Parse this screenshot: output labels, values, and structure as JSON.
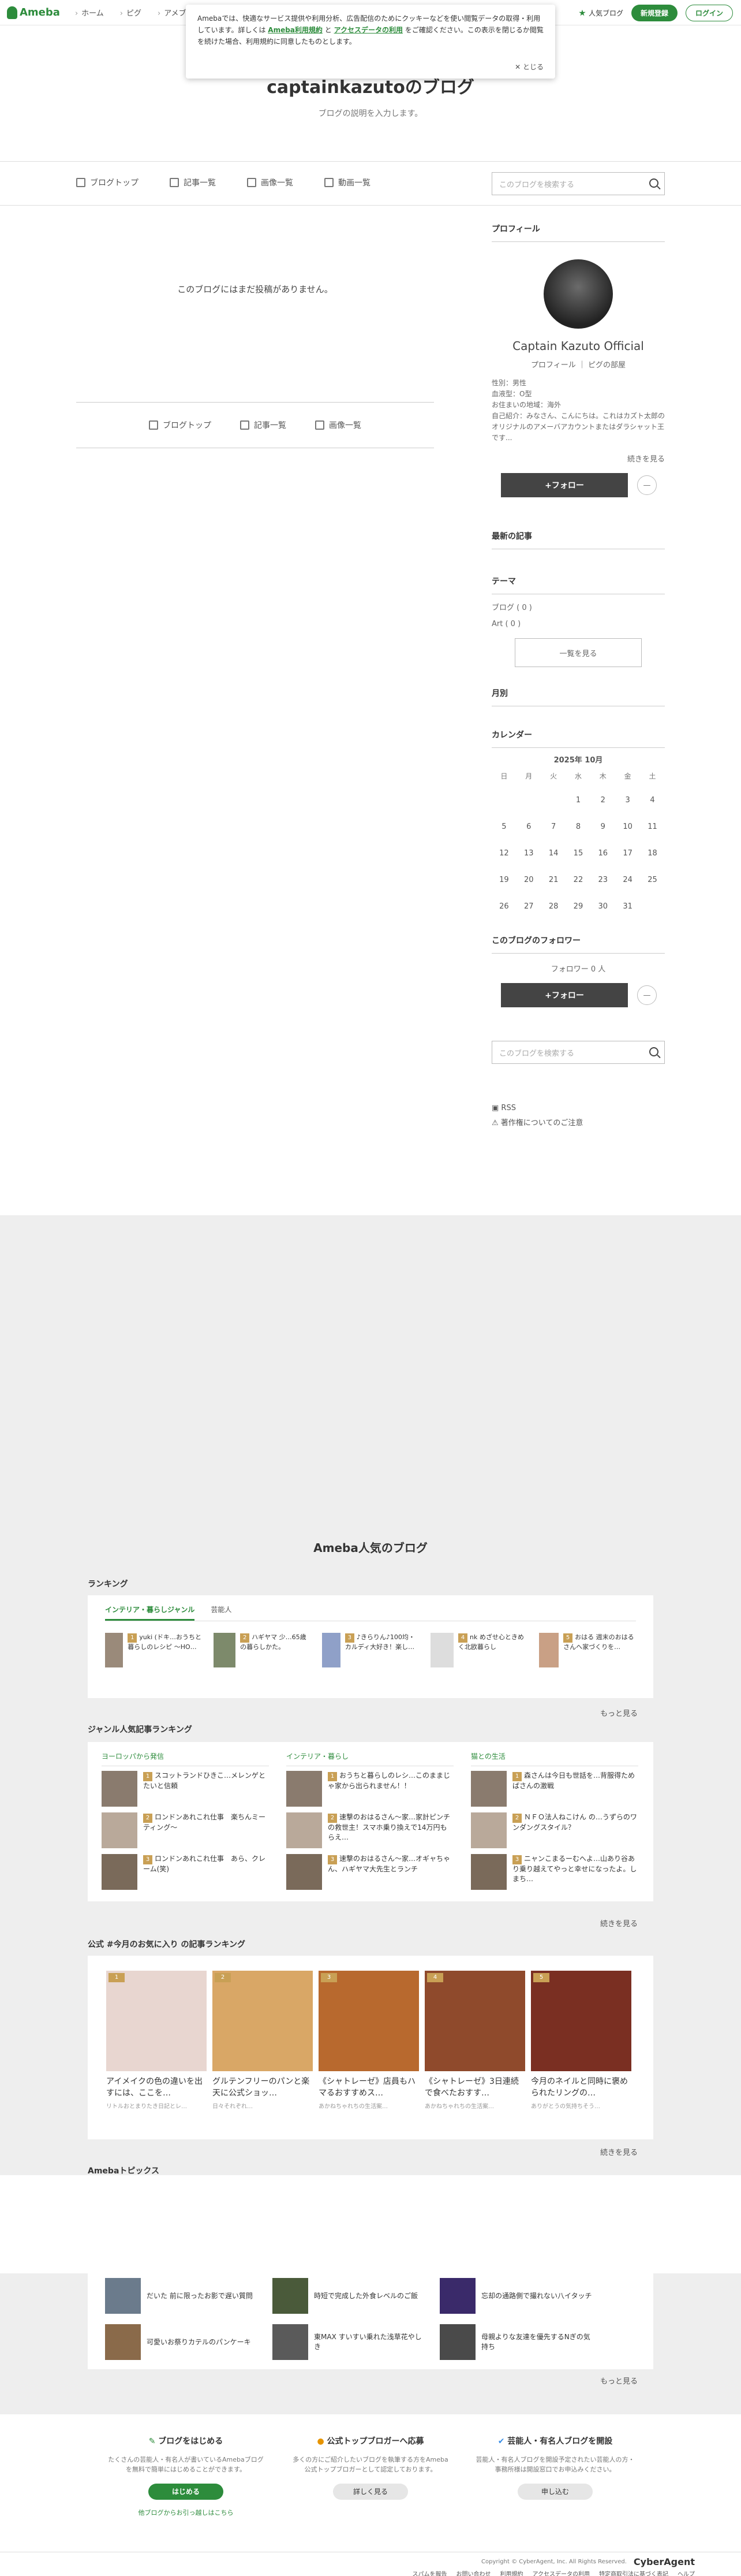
{
  "topbar": {
    "logo": "Ameba",
    "nav": [
      "ホーム",
      "ピグ",
      "アメブロ"
    ],
    "popular": "人気ブログ",
    "signup": "新規登録",
    "login": "ログイン"
  },
  "cookie": {
    "text1": "Amebaでは、快適なサービス提供や利用分析、広告配信のためにクッキーなどを使い閲覧データの取得・利用しています。詳しくは",
    "link1": "Ameba利用規約",
    "and": "と",
    "link2": "アクセスデータの利用",
    "text2": "をご確認ください。この表示を閉じるか閲覧を続けた場合、利用規約に同意したものとします。",
    "close": "とじる"
  },
  "header": {
    "title": "captainkazutoのブログ",
    "desc": "ブログの説明を入力します。"
  },
  "subnav": {
    "items": [
      "ブログトップ",
      "記事一覧",
      "画像一覧",
      "動画一覧"
    ],
    "search_placeholder": "このブログを検索する"
  },
  "main": {
    "empty": "このブログにはまだ投稿がありません。",
    "bottom_nav": [
      "ブログトップ",
      "記事一覧",
      "画像一覧"
    ]
  },
  "profile": {
    "heading": "プロフィール",
    "name": "Captain Kazuto Official",
    "links": "プロフィール ｜ ピグの部屋",
    "gender": "性別：男性",
    "blood": "血液型：O型",
    "area": "お住まいの地域：海外",
    "intro": "自己紹介：みなさん、こんにちは。これはカズト太郎のオリジナルのアメーバアカウントまたはダラシャット王です...",
    "more": "続きを見る",
    "follow": "+フォロー"
  },
  "recent": {
    "heading": "最新の記事"
  },
  "theme": {
    "heading": "テーマ",
    "items": [
      "ブログ ( 0 )",
      "Art ( 0 )"
    ],
    "button": "一覧を見る"
  },
  "month": {
    "heading": "月別"
  },
  "calendar": {
    "heading": "カレンダー",
    "title": "2025年 10月",
    "weekdays": [
      "日",
      "月",
      "火",
      "水",
      "木",
      "金",
      "土"
    ],
    "weeks": [
      [
        "",
        "",
        "",
        "1",
        "2",
        "3",
        "4"
      ],
      [
        "5",
        "6",
        "7",
        "8",
        "9",
        "10",
        "11"
      ],
      [
        "12",
        "13",
        "14",
        "15",
        "16",
        "17",
        "18"
      ],
      [
        "19",
        "20",
        "21",
        "22",
        "23",
        "24",
        "25"
      ],
      [
        "26",
        "27",
        "28",
        "29",
        "30",
        "31",
        ""
      ]
    ]
  },
  "followers": {
    "heading": "このブログのフォロワー",
    "count": "フォロワー 0 人",
    "follow": "+フォロー"
  },
  "side_search": {
    "placeholder": "このブログを検索する"
  },
  "side_links": {
    "rss": "RSS",
    "copyright": "著作権についてのご注意"
  },
  "popular": {
    "title": "Ameba人気のブログ",
    "ranking_heading": "ランキング",
    "tabs": [
      "インテリア・暮らしジャンル",
      "芸能人"
    ],
    "ranking": [
      {
        "rank": "1",
        "text": "yuki (ドキ…おうちと暮らしのレシピ ～HO…"
      },
      {
        "rank": "2",
        "text": "ハギヤマ 少…65歳の暮らしかた。"
      },
      {
        "rank": "3",
        "text": "♪きらりん♪100均・カルディ大好き！楽し…"
      },
      {
        "rank": "4",
        "text": "nk めざせ心ときめく北欧暮らし"
      },
      {
        "rank": "5",
        "text": "おはる 週末のおはるさんへ家づくりを…"
      }
    ],
    "more": "もっと見る",
    "genre_heading": "ジャンル人気記事ランキング",
    "genres": [
      {
        "name": "ヨーロッパから発信",
        "items": [
          {
            "r": "1",
            "t": "スコットランドひきこ…メレンゲとたいと信頼"
          },
          {
            "r": "2",
            "t": "ロンドンあれこれ仕事　楽ちんミーティング～"
          },
          {
            "r": "3",
            "t": "ロンドンあれこれ仕事　あら、クレーム(笑)"
          }
        ]
      },
      {
        "name": "インテリア・暮らし",
        "items": [
          {
            "r": "1",
            "t": "おうちと暮らしのレシ…このままじゃ家から出られません！！"
          },
          {
            "r": "2",
            "t": "速撃のおはるさん～家…家計ピンチの救世主！スマホ乗り換えで14万円もらえ…"
          },
          {
            "r": "3",
            "t": "速撃のおはるさん～家…オギャちゃん、ハギヤマ大先生とランチ"
          }
        ]
      },
      {
        "name": "猫との生活",
        "items": [
          {
            "r": "1",
            "t": "森さんは今日も世話を…背服得ためばさんの激戦"
          },
          {
            "r": "2",
            "t": "ＮＦＯ法人ねこけん の…うずらのワンダングスタイル？"
          },
          {
            "r": "3",
            "t": "ニャンこまるーむへよ…山あり谷あり乗り越えてやっと幸せになったよ。しまち…"
          }
        ]
      }
    ],
    "genre_more": "続きを見る",
    "official_heading": "公式 #今月のお気に入り の記事ランキング",
    "official": [
      {
        "rank": "1",
        "title": "アイメイクの色の違いを出すには、ここを…",
        "sub": "リトルおとまりたき日記とレ…"
      },
      {
        "rank": "2",
        "title": "グルテンフリーのパンと楽天に公式ショッ…",
        "sub": "日々それぞれ…"
      },
      {
        "rank": "3",
        "title": "《シャトレーゼ》店員もハマるおすすめス…",
        "sub": "あかねちゃれちの生活案…"
      },
      {
        "rank": "4",
        "title": "《シャトレーゼ》3日連続で食べたおすす…",
        "sub": "あかねちゃれちの生活案…"
      },
      {
        "rank": "5",
        "title": "今月のネイルと同時に褒められたリングの…",
        "sub": "ありがとうの気持ちそう…"
      }
    ],
    "official_more": "続きを見る",
    "topics_heading": "Amebaトピックス",
    "topics": [
      "だいた 前に限ったお影で遅い質問",
      "時短で完成した外食レベルのご飯",
      "忘却の通路側で撮れない八イタッチ",
      "可愛いお祭りカテルのパンケーキ",
      "東MAX すいすい乗れた浅草花やしき",
      "母親よりな友達を優先するNぎの気持ち"
    ],
    "topics_more": "もっと見る"
  },
  "footer": {
    "c1_title": "ブログをはじめる",
    "c1_desc": "たくさんの芸能人・有名人が書いているAmebaブログを無料で簡単にはじめることができます。",
    "c1_btn": "はじめる",
    "c1_link": "他ブログからお引っ越しはこちら",
    "c2_title": "公式トップブロガーへ応募",
    "c2_desc": "多くの方にご紹介したいブログを執筆する方をAmeba公式トップブロガーとして認定しております。",
    "c2_btn": "詳しく見る",
    "c3_title": "芸能人・有名人ブログを開設",
    "c3_desc": "芸能人・有名人ブログを開設予定されたい芸能人の方・事務所様は開設窓口でお申込みください。",
    "c3_btn": "申し込む",
    "copyright": "Copyright © CyberAgent, Inc. All Rights Reserved.",
    "brand": "CyberAgent",
    "links": [
      "スパムを報告",
      "お問い合わせ",
      "利用規約",
      "アクセスデータの利用",
      "特定商取引法に基づく表記",
      "ヘルプ"
    ]
  }
}
